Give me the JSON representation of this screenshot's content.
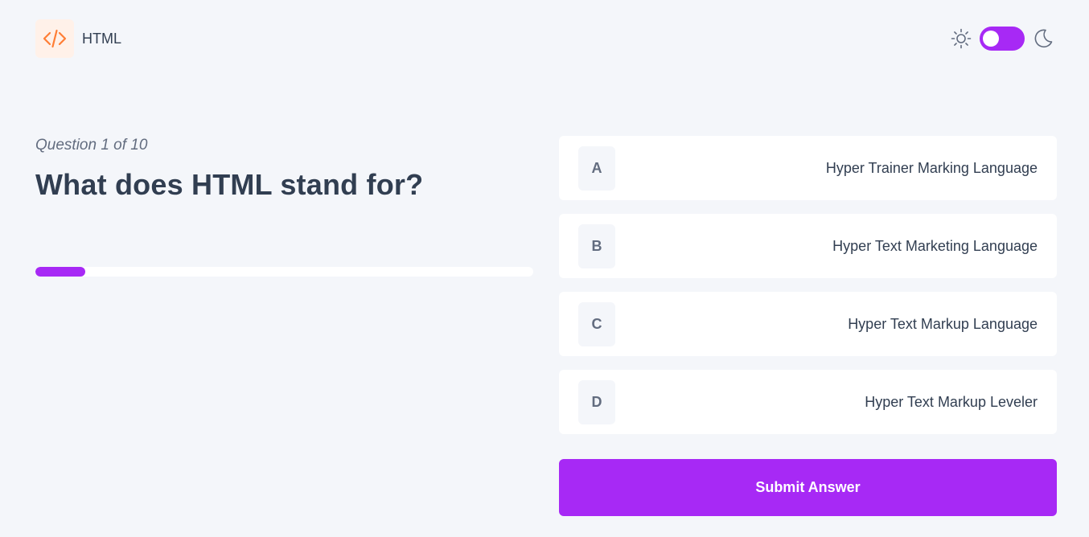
{
  "header": {
    "subject_icon": "code-brackets-icon",
    "subject_title": "HTML",
    "theme_toggle": {
      "light_icon": "sun-icon",
      "dark_icon": "moon-icon",
      "dark_mode": false
    }
  },
  "quiz": {
    "counter": "Question 1 of 10",
    "question": "What does HTML stand for?",
    "progress": 0.1
  },
  "options": [
    {
      "letter": "A",
      "text": "Hyper Trainer Marking Language"
    },
    {
      "letter": "B",
      "text": "Hyper Text Marketing Language"
    },
    {
      "letter": "C",
      "text": "Hyper Text Markup Language"
    },
    {
      "letter": "D",
      "text": "Hyper Text Markup Leveler"
    }
  ],
  "submit_label": "Submit Answer",
  "colors": {
    "accent": "#a729f5",
    "background": "#f4f6fa",
    "subject_icon_bg": "#fff1e9",
    "subject_icon_fg": "#ff7e35",
    "text": "#313e51",
    "muted": "#626c7f"
  }
}
